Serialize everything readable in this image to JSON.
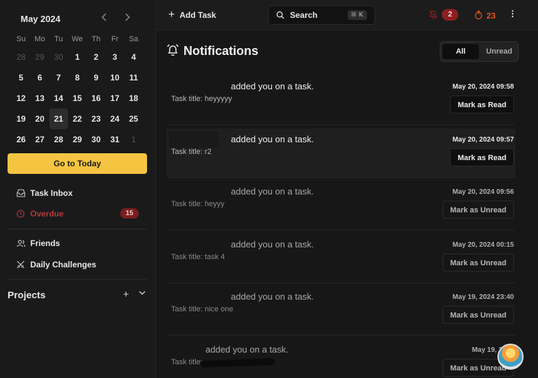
{
  "calendar": {
    "title": "May 2024",
    "prev_icon": "chevron-left-icon",
    "next_icon": "chevron-right-icon",
    "weekdays": [
      "Su",
      "Mo",
      "Tu",
      "We",
      "Th",
      "Fr",
      "Sa"
    ],
    "weeks": [
      [
        {
          "d": "28",
          "muted": true
        },
        {
          "d": "29",
          "muted": true
        },
        {
          "d": "30",
          "muted": true
        },
        {
          "d": "1"
        },
        {
          "d": "2"
        },
        {
          "d": "3"
        },
        {
          "d": "4"
        }
      ],
      [
        {
          "d": "5"
        },
        {
          "d": "6"
        },
        {
          "d": "7"
        },
        {
          "d": "8"
        },
        {
          "d": "9"
        },
        {
          "d": "10"
        },
        {
          "d": "11"
        }
      ],
      [
        {
          "d": "12"
        },
        {
          "d": "13"
        },
        {
          "d": "14"
        },
        {
          "d": "15"
        },
        {
          "d": "16"
        },
        {
          "d": "17"
        },
        {
          "d": "18"
        }
      ],
      [
        {
          "d": "19"
        },
        {
          "d": "20"
        },
        {
          "d": "21",
          "today": true
        },
        {
          "d": "22"
        },
        {
          "d": "23"
        },
        {
          "d": "24"
        },
        {
          "d": "25"
        }
      ],
      [
        {
          "d": "26"
        },
        {
          "d": "27"
        },
        {
          "d": "28"
        },
        {
          "d": "29"
        },
        {
          "d": "30"
        },
        {
          "d": "31"
        },
        {
          "d": "1",
          "muted": true
        }
      ]
    ],
    "go_today_label": "Go to Today"
  },
  "sidebar": {
    "task_inbox": "Task Inbox",
    "overdue": "Overdue",
    "overdue_count": "15",
    "friends": "Friends",
    "daily_challenges": "Daily Challenges",
    "projects": "Projects"
  },
  "topbar": {
    "add_task": "Add Task",
    "search": "Search",
    "search_shortcut": "⌘ K",
    "notif_count": "2",
    "streak_count": "23"
  },
  "main": {
    "title": "Notifications",
    "filter_all": "All",
    "filter_unread": "Unread"
  },
  "notifications": [
    {
      "message": "added you on a task.",
      "task": "Task title: heyyyyy",
      "time": "May 20, 2024 09:58",
      "action": "Mark as Read",
      "unread": true
    },
    {
      "message": "added you on a task.",
      "task": "Task title: r2",
      "time": "May 20, 2024 09:57",
      "action": "Mark as Read",
      "unread": true
    },
    {
      "message": "added you on a task.",
      "task": "Task title: heyyy",
      "time": "May 20, 2024 09:56",
      "action": "Mark as Unread",
      "unread": false
    },
    {
      "message": "added you on a task.",
      "task": "Task title: task 4",
      "time": "May 20, 2024 00:15",
      "action": "Mark as Unread",
      "unread": false
    },
    {
      "message": "added you on a task.",
      "task": "Task title: nice one",
      "time": "May 19, 2024 23:40",
      "action": "Mark as Unread",
      "unread": false
    },
    {
      "message": "added you on a task.",
      "task": "Task title:",
      "time": "May 19, 2024",
      "action": "Mark as Unread",
      "unread": false
    }
  ],
  "colors": {
    "accent_yellow": "#f5c542",
    "alert_red": "#8c1f1f",
    "streak_orange": "#e0551f"
  }
}
